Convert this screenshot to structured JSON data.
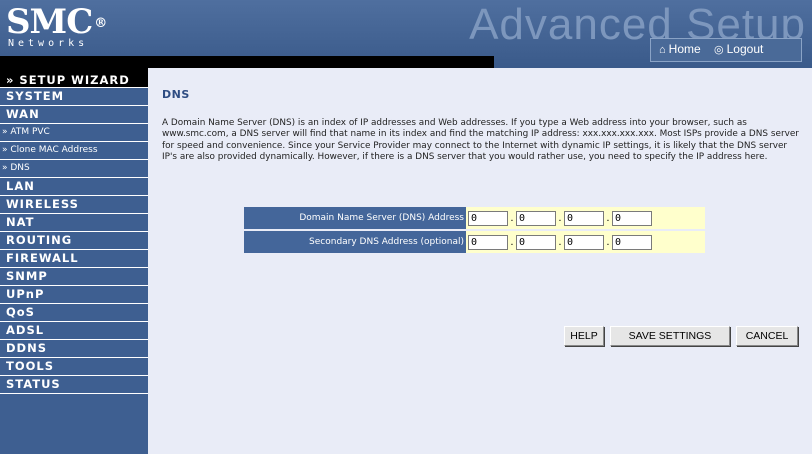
{
  "header": {
    "brand": "SMC",
    "brand_mark": "®",
    "brand_sub": "Networks",
    "title": "Advanced Setup",
    "links": [
      {
        "icon": "home-icon",
        "label": "Home"
      },
      {
        "icon": "logout-icon",
        "label": "Logout"
      }
    ]
  },
  "sidebar": {
    "wizard": "» SETUP WIZARD",
    "items": [
      {
        "label": "SYSTEM",
        "type": "main"
      },
      {
        "label": "WAN",
        "type": "main"
      },
      {
        "label": "» ATM PVC",
        "type": "sub"
      },
      {
        "label": "» Clone MAC Address",
        "type": "sub"
      },
      {
        "label": "» DNS",
        "type": "sub"
      },
      {
        "label": "LAN",
        "type": "main"
      },
      {
        "label": "WIRELESS",
        "type": "main"
      },
      {
        "label": "NAT",
        "type": "main"
      },
      {
        "label": "ROUTING",
        "type": "main"
      },
      {
        "label": "FIREWALL",
        "type": "main"
      },
      {
        "label": "SNMP",
        "type": "main"
      },
      {
        "label": "UPnP",
        "type": "main"
      },
      {
        "label": "QoS",
        "type": "main"
      },
      {
        "label": "ADSL",
        "type": "main"
      },
      {
        "label": "DDNS",
        "type": "main"
      },
      {
        "label": "TOOLS",
        "type": "main"
      },
      {
        "label": "STATUS",
        "type": "main"
      }
    ]
  },
  "main": {
    "title": "DNS",
    "intro": "A Domain Name Server (DNS) is an index of IP addresses and Web addresses. If you type a Web address into your browser, such as www.smc.com, a DNS server will find that name in its index and find the matching IP address: xxx.xxx.xxx.xxx. Most ISPs provide a DNS server for speed and convenience. Since your Service Provider may connect to the Internet with dynamic IP settings, it is likely that the DNS server IP's are also provided dynamically. However, if there is a DNS server that you would rather use, you need to specify the IP address here.",
    "dns_rows": [
      {
        "label": "Domain Name Server (DNS) Address",
        "octets": [
          "0",
          "0",
          "0",
          "0"
        ]
      },
      {
        "label": "Secondary DNS Address (optional)",
        "octets": [
          "0",
          "0",
          "0",
          "0"
        ]
      }
    ],
    "buttons": {
      "help": "HELP",
      "save": "SAVE SETTINGS",
      "cancel": "CANCEL"
    }
  },
  "colors": {
    "header_bg": "#4a6a98",
    "sidebar_bg": "#3e5f91",
    "content_bg": "#e9ecf7",
    "title_color": "#2e4c82",
    "field_bg": "#ffffcc"
  }
}
